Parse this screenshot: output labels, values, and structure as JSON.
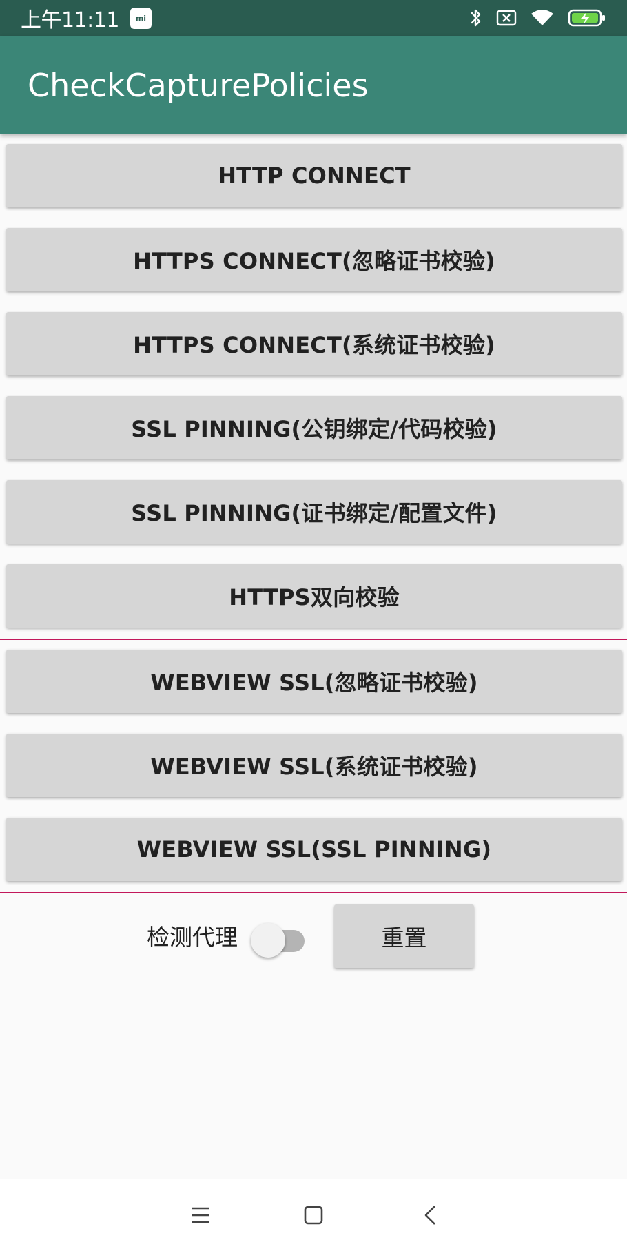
{
  "status_bar": {
    "time": "上午11:11",
    "mi_badge": "mi",
    "icons": [
      "bluetooth-icon",
      "sim-x-icon",
      "wifi-icon",
      "battery-charging-icon"
    ]
  },
  "app_bar": {
    "title": "CheckCapturePolicies"
  },
  "buttons": [
    {
      "label": "HTTP CONNECT"
    },
    {
      "label": "HTTPS CONNECT(忽略证书校验)"
    },
    {
      "label": "HTTPS CONNECT(系统证书校验)"
    },
    {
      "label": "SSL PINNING(公钥绑定/代码校验)"
    },
    {
      "label": "SSL PINNING(证书绑定/配置文件)"
    },
    {
      "label": "HTTPS双向校验"
    }
  ],
  "webview_buttons": [
    {
      "label": "WEBVIEW SSL(忽略证书校验)"
    },
    {
      "label": "WEBVIEW SSL(系统证书校验)"
    },
    {
      "label": "WEBVIEW SSL(SSL PINNING)"
    }
  ],
  "controls": {
    "proxy_label": "检测代理",
    "proxy_switch_on": false,
    "reset_label": "重置"
  },
  "nav_bar": {
    "icons": [
      "menu-icon",
      "home-icon",
      "back-icon"
    ]
  },
  "colors": {
    "status_bar": "#2a5c50",
    "app_bar": "#3b8677",
    "divider": "#c2185b",
    "button": "#d6d6d6"
  }
}
